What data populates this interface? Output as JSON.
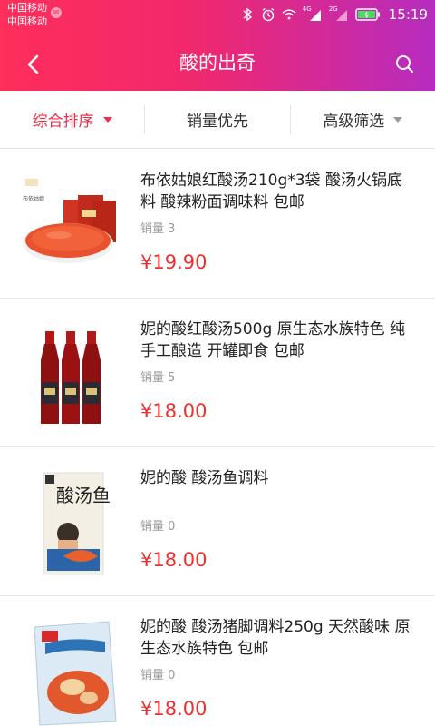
{
  "statusbar": {
    "carrier_1": "中国移动",
    "carrier_2": "中国移动",
    "network_4g": "4G",
    "network_2g": "2G",
    "time": "15:19",
    "battery_color": "#4cd964"
  },
  "topbar": {
    "title": "酸的出奇",
    "back_icon": "chevron-left-icon",
    "search_icon": "search-icon"
  },
  "sort_tabs": [
    {
      "label": "综合排序",
      "active": true
    },
    {
      "label": "销量优先",
      "active": false
    },
    {
      "label": "高级筛选",
      "active": false
    }
  ],
  "products": [
    {
      "title": "布依姑娘红酸汤210g*3袋 酸汤火锅底料 酸辣粉面调味料 包邮",
      "sales": "销量 3",
      "price": "¥19.90",
      "thumb_brand_text": "布依姑娘"
    },
    {
      "title": "妮的酸红酸汤500g 原生态水族特色 纯手工酿造 开罐即食 包邮",
      "sales": "销量 5",
      "price": "¥18.00"
    },
    {
      "title": "妮的酸 酸汤鱼调料",
      "sales": "销量 0",
      "price": "¥18.00",
      "thumb_pack_text": "酸汤鱼"
    },
    {
      "title": "妮的酸 酸汤猪脚调料250g 天然酸味 原生态水族特色 包邮",
      "sales": "销量 0",
      "price": "¥18.00"
    }
  ],
  "colors": {
    "header_gradient_start": "#ff2e5a",
    "header_gradient_end": "#b62cc0",
    "accent": "#ee2f4b",
    "price": "#ee2f2f"
  }
}
